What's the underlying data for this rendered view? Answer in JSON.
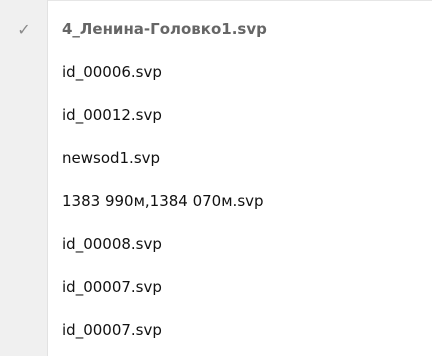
{
  "menu": {
    "check_glyph": "✓",
    "items": [
      {
        "label": "4_Ленина-Головко1.svp",
        "checked": true
      },
      {
        "label": "id_00006.svp",
        "checked": false
      },
      {
        "label": "id_00012.svp",
        "checked": false
      },
      {
        "label": "newsod1.svp",
        "checked": false
      },
      {
        "label": "1383 990м,1384 070м.svp",
        "checked": false
      },
      {
        "label": "id_00008.svp",
        "checked": false
      },
      {
        "label": "id_00007.svp",
        "checked": false
      },
      {
        "label": "id_00007.svp",
        "checked": false
      }
    ]
  }
}
